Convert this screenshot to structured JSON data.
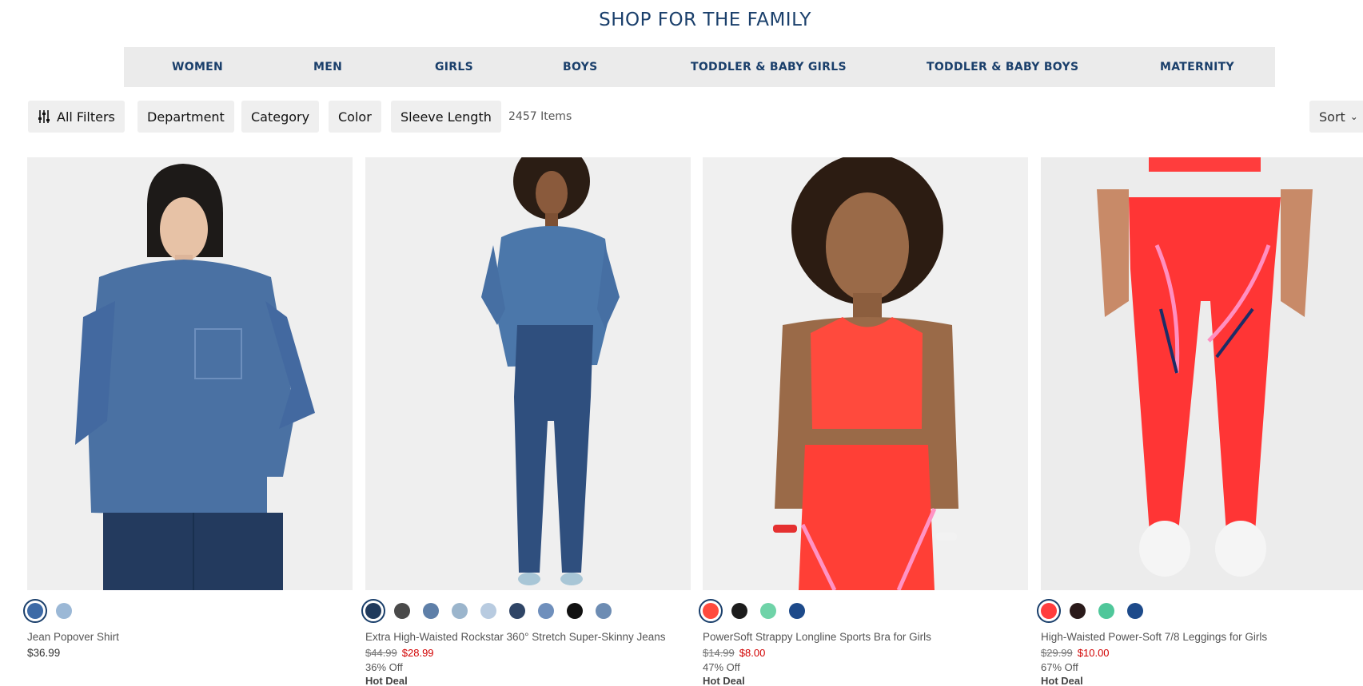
{
  "page_title": "SHOP FOR THE FAMILY",
  "categories": [
    "WOMEN",
    "MEN",
    "GIRLS",
    "BOYS",
    "TODDLER & BABY GIRLS",
    "TODDLER & BABY BOYS",
    "MATERNITY"
  ],
  "filters": {
    "all_filters": "All Filters",
    "department": "Department",
    "category": "Category",
    "color": "Color",
    "sleeve_length": "Sleeve Length",
    "item_count": "2457 Items",
    "sort": "Sort"
  },
  "products": [
    {
      "name": "Jean Popover Shirt",
      "price": "$36.99",
      "swatches": [
        "#3d6aa6",
        "#9bb8d6"
      ],
      "selected_swatch": 0
    },
    {
      "name": "Extra High-Waisted Rockstar 360° Stretch Super-Skinny Jeans",
      "original_price": "$44.99",
      "sale_price": "$28.99",
      "discount": "36% Off",
      "badge": "Hot Deal",
      "swatches": [
        "#203a5c",
        "#4a4a4a",
        "#5e7fa8",
        "#9bb5cc",
        "#b8cbe0",
        "#2f4566",
        "#6f8fbc",
        "#111111",
        "#6d8cb3"
      ],
      "selected_swatch": 0
    },
    {
      "name": "PowerSoft Strappy Longline Sports Bra for Girls",
      "original_price": "$14.99",
      "sale_price": "$8.00",
      "discount": "47% Off",
      "badge": "Hot Deal",
      "swatches": [
        "#ff4a3d",
        "#1c1c1c",
        "#6fd3a8",
        "#1d4a8a"
      ],
      "selected_swatch": 0
    },
    {
      "name": "High-Waisted Power-Soft 7/8 Leggings for Girls",
      "original_price": "$29.99",
      "sale_price": "$10.00",
      "discount": "67% Off",
      "badge": "Hot Deal",
      "swatches": [
        "#ff3d3d",
        "#2a1a1a",
        "#4fc79a",
        "#1d4a8a"
      ],
      "selected_swatch": 0
    }
  ]
}
